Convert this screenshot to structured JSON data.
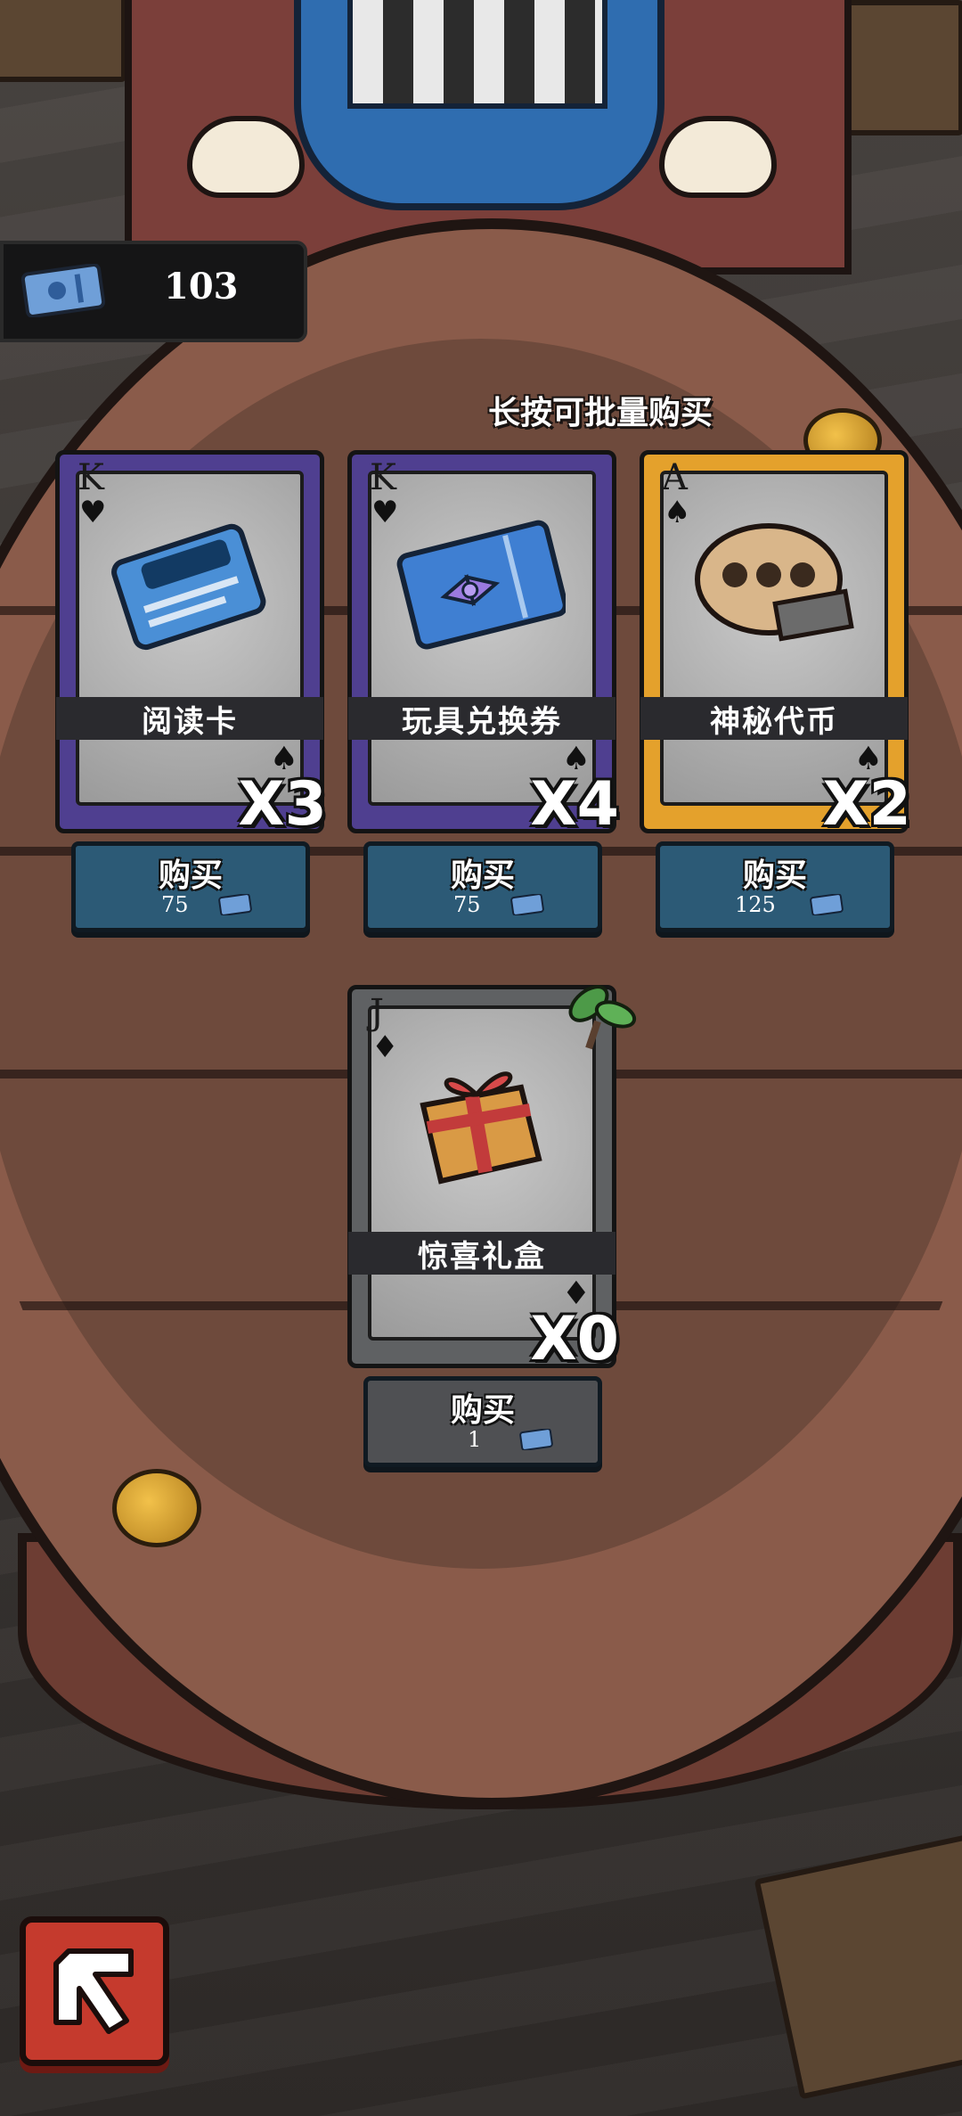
{
  "currency": {
    "icon": "ticket-icon",
    "amount": "103"
  },
  "hint": "长按可批量购买",
  "shop_items": [
    {
      "name": "阅读卡",
      "rank": "K",
      "suit": "♥",
      "quantity": "X3",
      "buy_label": "购买",
      "price": "75",
      "card_color": "#4f3f90",
      "art_icon": "reading-card-icon"
    },
    {
      "name": "玩具兑换券",
      "rank": "K",
      "suit": "♥",
      "quantity": "X4",
      "buy_label": "购买",
      "price": "75",
      "card_color": "#4f3f90",
      "art_icon": "toy-voucher-icon"
    },
    {
      "name": "神秘代币",
      "rank": "A",
      "suit": "♠",
      "quantity": "X2",
      "buy_label": "购买",
      "price": "125",
      "card_color": "#e4a12c",
      "art_icon": "film-reel-icon"
    },
    {
      "name": "惊喜礼盒",
      "rank": "J",
      "suit": "♦",
      "quantity": "X0",
      "buy_label": "购买",
      "price": "1",
      "card_color": "#5f6163",
      "art_icon": "gift-box-icon"
    }
  ],
  "colors": {
    "button_blue": "#2c5a76",
    "button_grey": "#4f5053",
    "back_button": "#c53a2d",
    "table_wood": "#8a5b4a"
  },
  "back_button_icon": "exit-arrow-icon"
}
